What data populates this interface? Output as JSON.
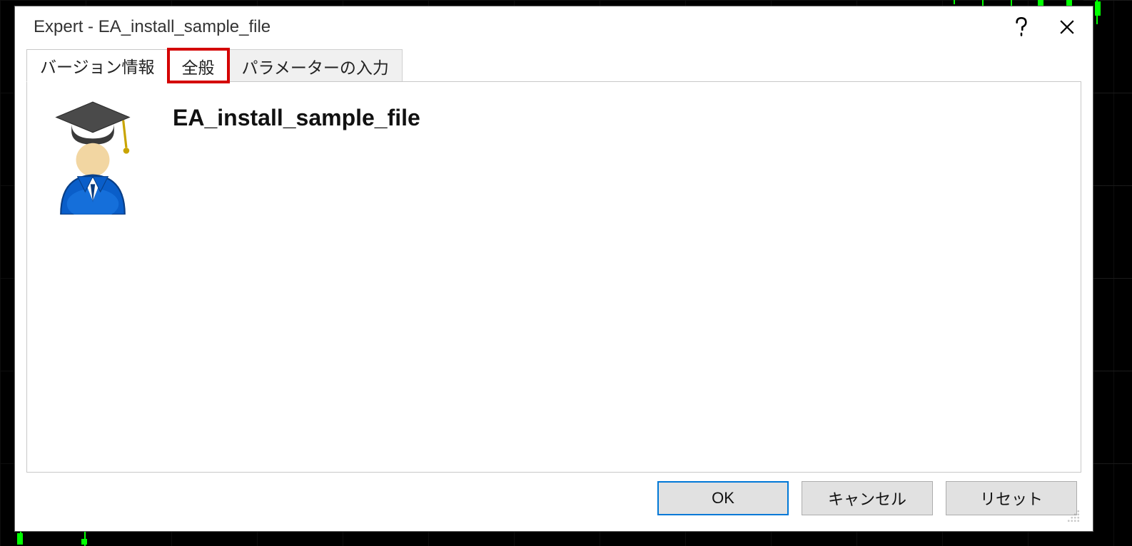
{
  "window": {
    "title": "Expert - EA_install_sample_file"
  },
  "tabs": {
    "version_info": "バージョン情報",
    "general": "全般",
    "inputs": "パラメーターの入力"
  },
  "panel": {
    "expert_name": "EA_install_sample_file"
  },
  "buttons": {
    "ok": "OK",
    "cancel": "キャンセル",
    "reset": "リセット"
  }
}
